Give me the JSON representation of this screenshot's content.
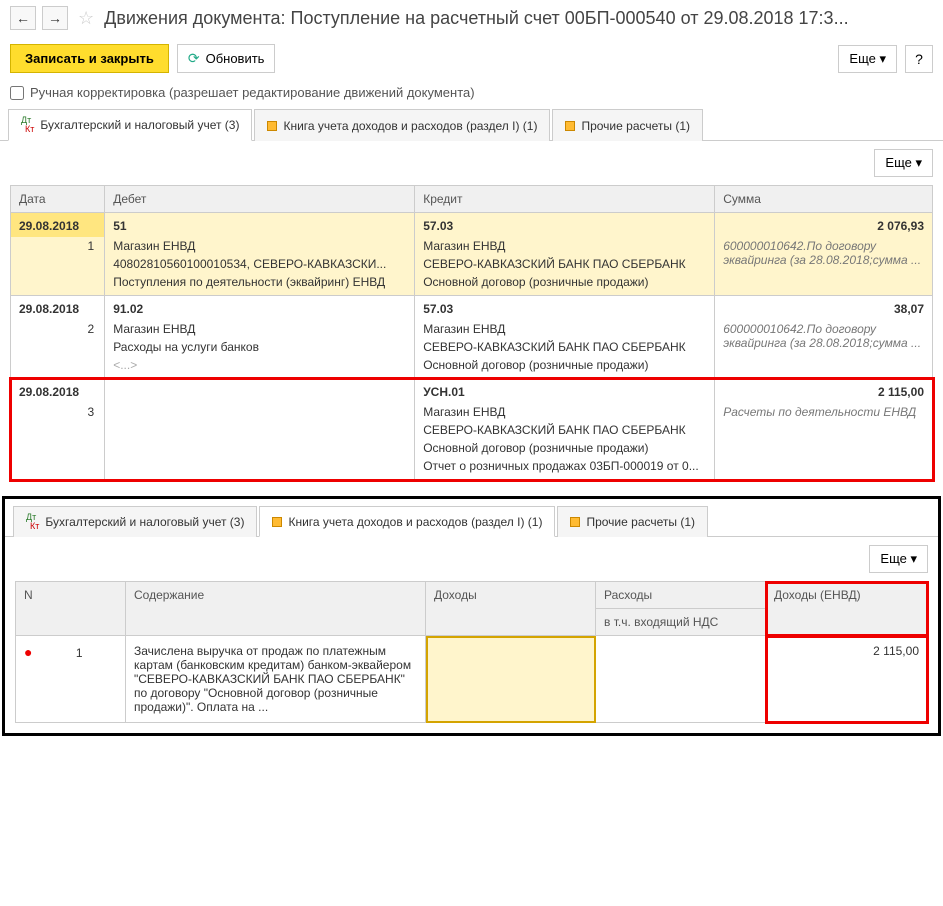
{
  "nav": {
    "back": "←",
    "forward": "→"
  },
  "header": {
    "title": "Движения документа: Поступление на расчетный счет 00БП-000540 от 29.08.2018 17:3..."
  },
  "toolbar": {
    "save_close": "Записать и закрыть",
    "refresh": "Обновить",
    "more": "Еще",
    "help": "?"
  },
  "checkbox": {
    "label": "Ручная корректировка (разрешает редактирование движений документа)"
  },
  "tabs": {
    "panel1": [
      {
        "label": "Бухгалтерский и налоговый учет (3)",
        "icon": "dtkt"
      },
      {
        "label": "Книга учета доходов и расходов (раздел I) (1)",
        "icon": "yellow"
      },
      {
        "label": "Прочие расчеты (1)",
        "icon": "yellow"
      }
    ],
    "panel2": [
      {
        "label": "Бухгалтерский и налоговый учет (3)",
        "icon": "dtkt"
      },
      {
        "label": "Книга учета доходов и расходов (раздел I) (1)",
        "icon": "yellow"
      },
      {
        "label": "Прочие расчеты (1)",
        "icon": "yellow"
      }
    ]
  },
  "table1": {
    "headers": {
      "date": "Дата",
      "debit": "Дебет",
      "credit": "Кредит",
      "sum": "Сумма"
    },
    "rows": [
      {
        "date": "29.08.2018",
        "num": "1",
        "debit_main": "51",
        "credit_main": "57.03",
        "sum_main": "2 076,93",
        "debit_lines": [
          "Магазин ЕНВД",
          "40802810560100010534, СЕВЕРО-КАВКАЗСКИ...",
          "Поступления по деятельности (эквайринг) ЕНВД"
        ],
        "credit_lines": [
          "Магазин ЕНВД",
          "СЕВЕРО-КАВКАЗСКИЙ БАНК ПАО СБЕРБАНК",
          "Основной договор (розничные продажи)"
        ],
        "note": "600000010642.По договору эквайринга (за 28.08.2018;сумма ..."
      },
      {
        "date": "29.08.2018",
        "num": "2",
        "debit_main": "91.02",
        "credit_main": "57.03",
        "sum_main": "38,07",
        "debit_lines": [
          "Магазин ЕНВД",
          "Расходы на услуги банков",
          "<...>"
        ],
        "credit_lines": [
          "Магазин ЕНВД",
          "СЕВЕРО-КАВКАЗСКИЙ БАНК ПАО СБЕРБАНК",
          "Основной договор (розничные продажи)"
        ],
        "note": "600000010642.По договору эквайринга (за 28.08.2018;сумма ..."
      },
      {
        "date": "29.08.2018",
        "num": "3",
        "debit_main": "",
        "credit_main": "УСН.01",
        "sum_main": "2 115,00",
        "debit_lines": [
          "",
          "",
          "",
          ""
        ],
        "credit_lines": [
          "Магазин ЕНВД",
          "СЕВЕРО-КАВКАЗСКИЙ БАНК ПАО СБЕРБАНК",
          "Основной договор (розничные продажи)",
          "Отчет о розничных продажах 03БП-000019 от 0..."
        ],
        "note": "Расчеты по деятельности ЕНВД"
      }
    ]
  },
  "table2": {
    "headers": {
      "n": "N",
      "content": "Содержание",
      "income": "Доходы",
      "expense": "Расходы",
      "expense_sub": "в т.ч. входящий НДС",
      "income_envd": "Доходы (ЕНВД)"
    },
    "row": {
      "num": "1",
      "content": "Зачислена выручка от продаж по платежным картам (банковским кредитам) банком-эквайером \"СЕВЕРО-КАВКАЗСКИЙ БАНК ПАО СБЕРБАНК\" по договору \"Основной договор (розничные продажи)\". Оплата на ...",
      "income": "",
      "expense": "",
      "income_envd": "2 115,00"
    }
  }
}
